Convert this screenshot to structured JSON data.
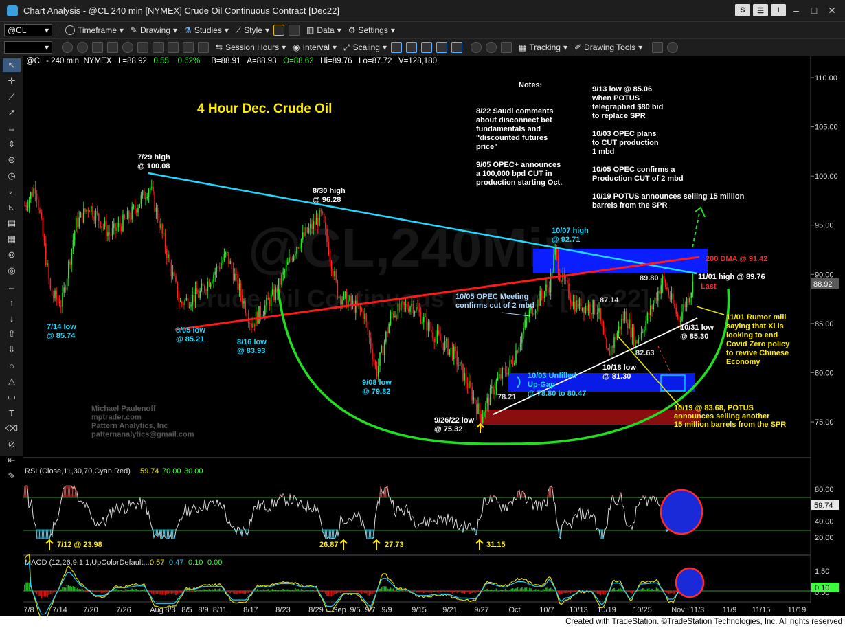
{
  "window": {
    "title": "Chart Analysis - @CL 240 min [NYMEX] Crude Oil Continuous Contract [Dec22]"
  },
  "toolbar1": {
    "symbol": "@CL",
    "timeframe": "Timeframe",
    "drawing": "Drawing",
    "studies": "Studies",
    "style": "Style",
    "data": "Data",
    "settings": "Settings"
  },
  "toolbar2": {
    "session_hours": "Session Hours",
    "interval": "Interval",
    "scaling": "Scaling",
    "tracking": "Tracking",
    "drawing_tools": "Drawing Tools"
  },
  "header": {
    "symbol": "@CL - 240 min",
    "exchange": "NYMEX",
    "last": "L=88.92",
    "chg": "0.55",
    "pct": "0.62%",
    "bid": "B=88.91",
    "ask": "A=88.93",
    "open": "O=88.62",
    "hi": "Hi=89.76",
    "lo": "Lo=87.72",
    "vol": "V=128,180"
  },
  "chart_title": "4 Hour Dec. Crude Oil",
  "watermark": {
    "line1": "@CL,240Min",
    "line2": "Crude Oil Continuous Contract [Dec22]"
  },
  "credit": [
    "Michael Paulenoff",
    "mptrader.com",
    "Pattern Analytics, Inc",
    "patternanalytics@gmail.com"
  ],
  "notes": {
    "title": "Notes:",
    "left": [
      "8/22 Saudi comments",
      "about disconnect bet",
      "fundamentals and",
      "\"discounted futures",
      "price\"",
      "",
      "9/05 OPEC+ announces",
      "a 100,000 bpd CUT in",
      "production starting Oct."
    ],
    "right": [
      "9/13 low @ 85.06",
      "when POTUS",
      "telegraphed $80 bid",
      "to replace SPR",
      "",
      "10/03 OPEC plans",
      "to CUT production",
      "1 mbd",
      "",
      "10/05 OPEC confirms a",
      "Production CUT of 2 mbd",
      "",
      "10/19 POTUS announces selling 15 million",
      "barrels from the SPR"
    ]
  },
  "annotations": {
    "h729": [
      "7/29 high",
      "@ 100.08"
    ],
    "l714": [
      "7/14 low",
      "@ 85.74"
    ],
    "l805": [
      "8/05 low",
      "@ 85.21"
    ],
    "l816": [
      "8/16 low",
      "@ 83.93"
    ],
    "h830": [
      "8/30 high",
      "@ 96.28"
    ],
    "l908": [
      "9/08 low",
      "@ 79.82"
    ],
    "l926": [
      "9/26/22 low",
      "@ 75.32"
    ],
    "opec1005": [
      "10/05 OPEC Meeting",
      "confirms cut of 2 mbd"
    ],
    "h1007": [
      "10/07 high",
      "@ 92.71"
    ],
    "gap1003": [
      "10/03 Unfilled",
      "Up-Gap",
      "@ 78.80 to 80.47"
    ],
    "p7821": "78.21",
    "p8714": "87.14",
    "p8980": "89.80",
    "p8263": "82.63",
    "l1018": [
      "10/18 low",
      "@ 81.30"
    ],
    "l1031": [
      "10/31 low",
      "@ 85.30"
    ],
    "h1101": "11/01 high @ 89.76",
    "last": "Last",
    "dma": "200 DMA @ 91.42",
    "rumor": [
      "11/01 Rumor mill",
      "saying that Xi is",
      "looking to end",
      "Covid Zero policy",
      "to revive Chinese",
      "Economy"
    ],
    "spr1019": [
      "10/19 @ 83.68, POTUS",
      "announces selling another",
      "15 million barrels from the SPR"
    ]
  },
  "price_axis": {
    "ticks": [
      "110.00",
      "105.00",
      "100.00",
      "95.00",
      "90.00",
      "85.00",
      "80.00",
      "75.00"
    ],
    "last_value": "88.92"
  },
  "rsi": {
    "label": "RSI (Close,11,30,70,Cyan,Red)",
    "value": "59.74",
    "ob": "70.00",
    "os": "30.00",
    "ticks": [
      "80.00",
      "60.00",
      "40.00",
      "20.00"
    ],
    "marks": [
      "7/12 @ 23.98",
      "26.87",
      "27.73",
      "31.15"
    ]
  },
  "macd": {
    "label": "MACD (12,26,9,1,1,UpColorDefault,...",
    "v1": "0.57",
    "v2": "0.47",
    "v3": "0.10",
    "v4": "0.00",
    "ticks": [
      "1.50",
      "0.50"
    ],
    "last_value": "0.10"
  },
  "date_axis": [
    "7/8",
    "7/14",
    "7/20",
    "7/26",
    "Aug",
    "8/3",
    "8/5",
    "8/9",
    "8/11",
    "8/17",
    "8/23",
    "8/29",
    "Sep",
    "9/5",
    "9/7",
    "9/9",
    "9/15",
    "9/21",
    "9/27",
    "Oct",
    "10/7",
    "10/13",
    "10/19",
    "10/25",
    "Nov",
    "11/3",
    "11/9",
    "11/15",
    "11/19"
  ],
  "status": "Created with TradeStation. ©TradeStation Technologies, Inc. All rights reserved",
  "colors": {
    "cyan": "#00e0ff",
    "yellow": "#ffff00",
    "red_line": "#ff1a1a",
    "green_arc": "#22dd22",
    "blue_zone": "#0a1eff"
  }
}
